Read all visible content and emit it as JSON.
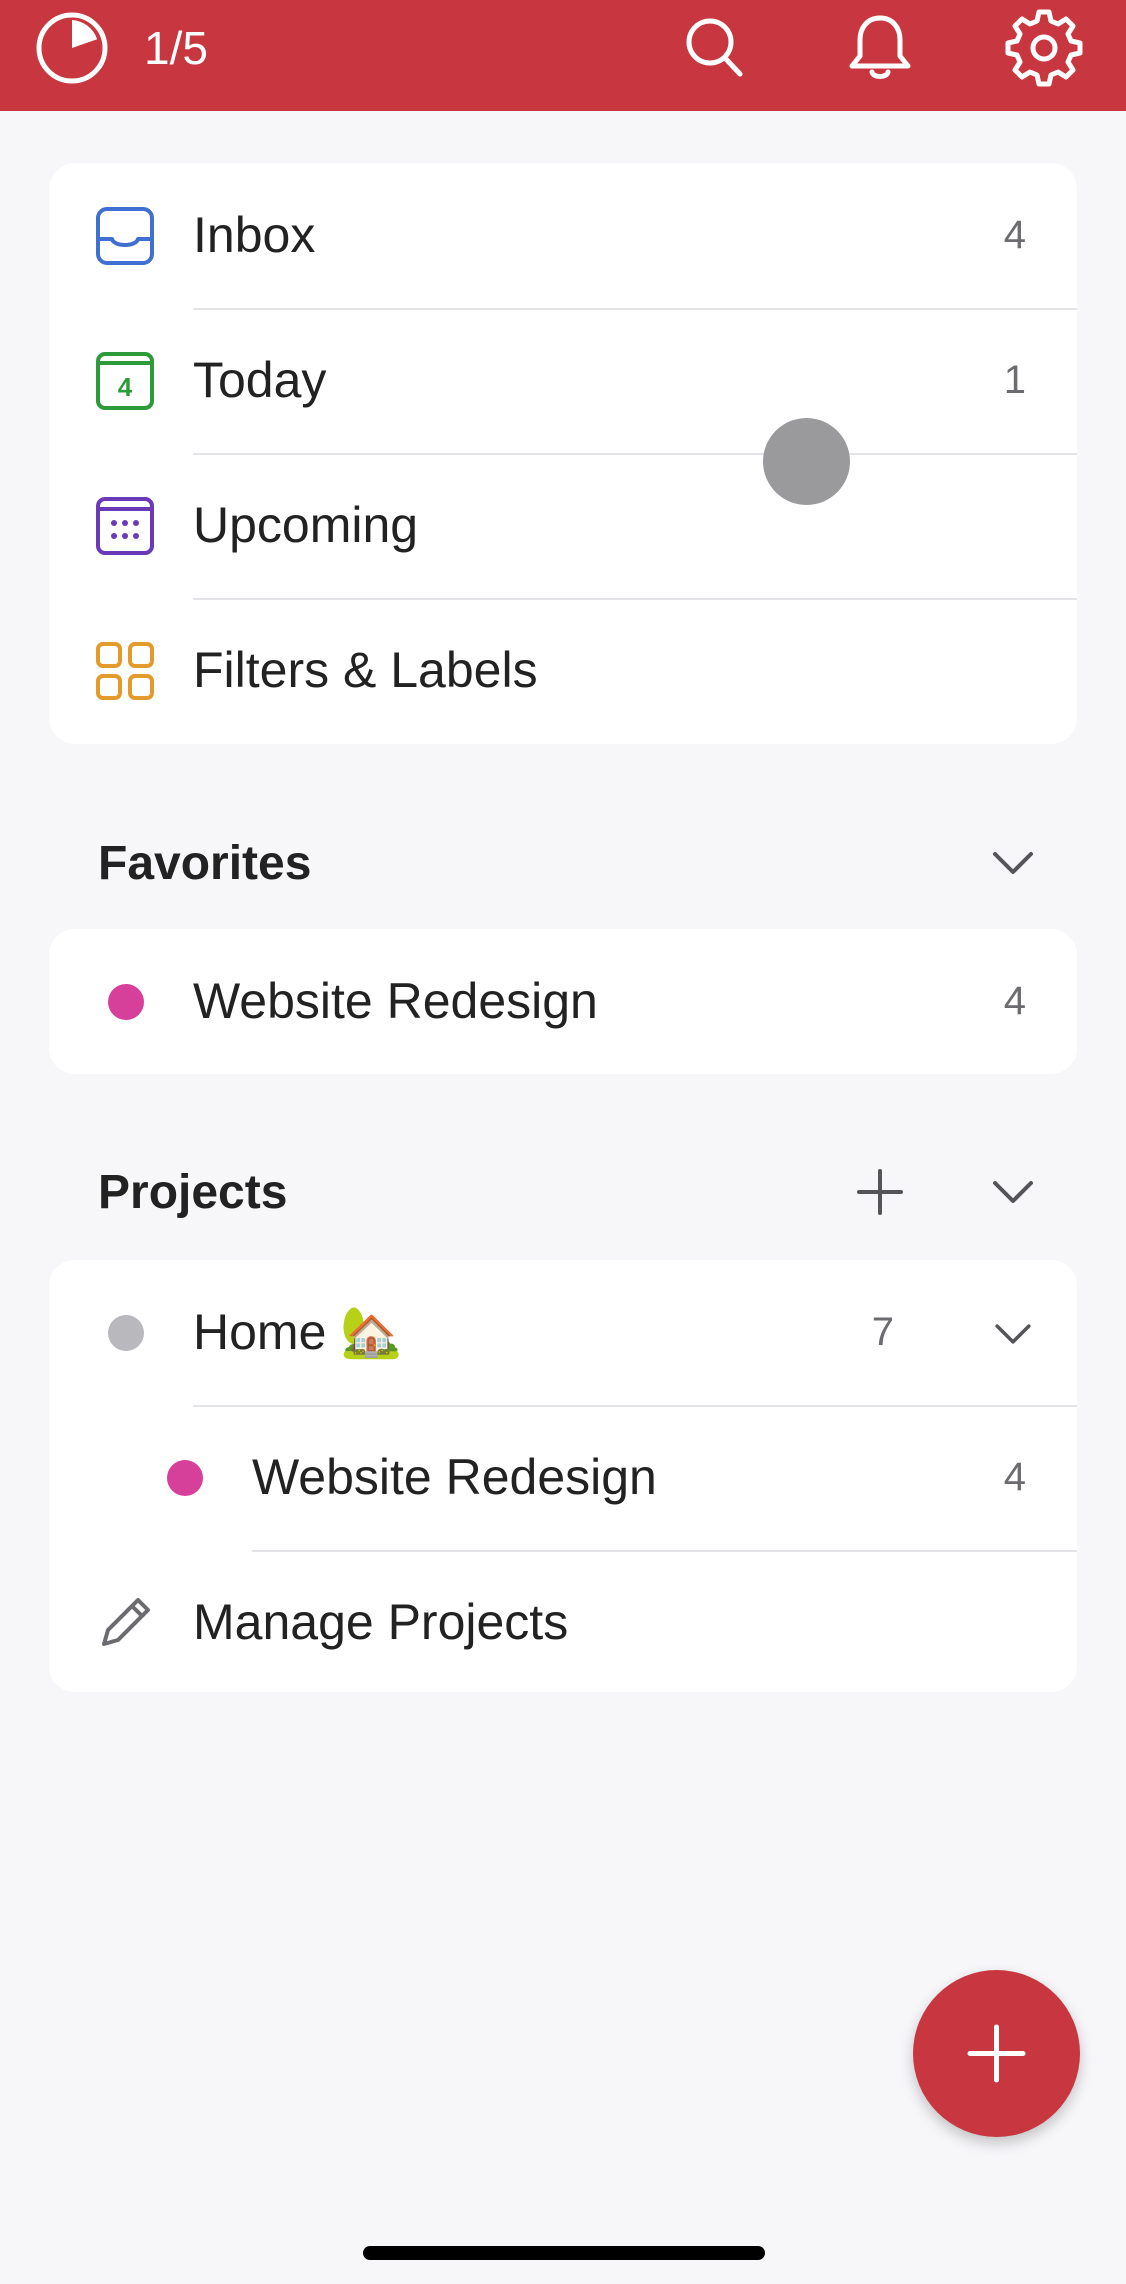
{
  "status_bar": {
    "progress_text": "1/5",
    "progress_fraction": 0.2,
    "progress_icon": "pie-progress-icon",
    "icons": [
      "search-icon",
      "bell-icon",
      "gear-icon"
    ],
    "color": "#c8363f"
  },
  "nav": {
    "items": [
      {
        "label": "Inbox",
        "count": "4",
        "icon": "inbox-icon",
        "color": "#3e6fd1"
      },
      {
        "label": "Today",
        "count": "1",
        "icon": "calendar-today-icon",
        "icon_text": "4",
        "color": "#2e9b3a"
      },
      {
        "label": "Upcoming",
        "count": "",
        "icon": "calendar-upcoming-icon",
        "color": "#6b3ab8"
      },
      {
        "label": "Filters & Labels",
        "count": "",
        "icon": "filters-grid-icon",
        "color": "#e49b2b"
      }
    ]
  },
  "favorites": {
    "title": "Favorites",
    "items": [
      {
        "label": "Website Redesign",
        "count": "4",
        "color": "#d63f9a"
      }
    ]
  },
  "projects": {
    "title": "Projects",
    "items": [
      {
        "label": "Home 🏡",
        "count": "7",
        "color": "#b9b9bd"
      },
      {
        "label": "Website Redesign",
        "count": "4",
        "color": "#d63f9a"
      }
    ],
    "manage_label": "Manage Projects"
  },
  "fab": {
    "icon": "plus-icon",
    "color": "#c8363f"
  }
}
